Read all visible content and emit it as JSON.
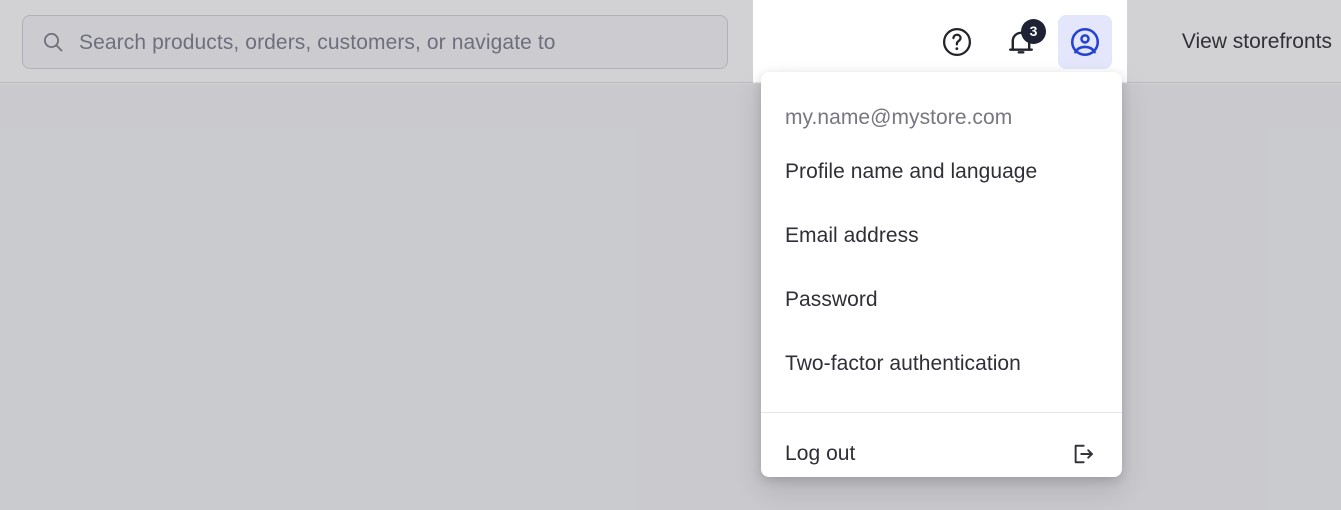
{
  "header": {
    "search": {
      "placeholder": "Search products, orders, customers, or navigate to",
      "value": "",
      "icon": "search-icon"
    },
    "actions": [
      {
        "id": "help",
        "icon": "question-circle-icon",
        "label": "Help"
      },
      {
        "id": "notifications",
        "icon": "bell-icon",
        "label": "Notifications",
        "badge": "3"
      },
      {
        "id": "account",
        "icon": "account-avatar-icon",
        "label": "Account",
        "active": true
      }
    ],
    "storefront_link": "View storefronts"
  },
  "account_menu": {
    "open": true,
    "email": "my.name@mystore.com",
    "items": [
      {
        "label": "Profile name and language"
      },
      {
        "label": "Email address"
      },
      {
        "label": "Password"
      },
      {
        "label": "Two-factor authentication"
      }
    ],
    "logout": {
      "label": "Log out",
      "icon": "sign-out-icon"
    }
  },
  "colors": {
    "accent": "#2443d1",
    "accent_bg": "#e4e6fb",
    "badge_bg": "#1f2234",
    "text": "#2f3037",
    "muted_text": "#76777f",
    "overlay": "rgba(106,107,117,0.30)"
  }
}
